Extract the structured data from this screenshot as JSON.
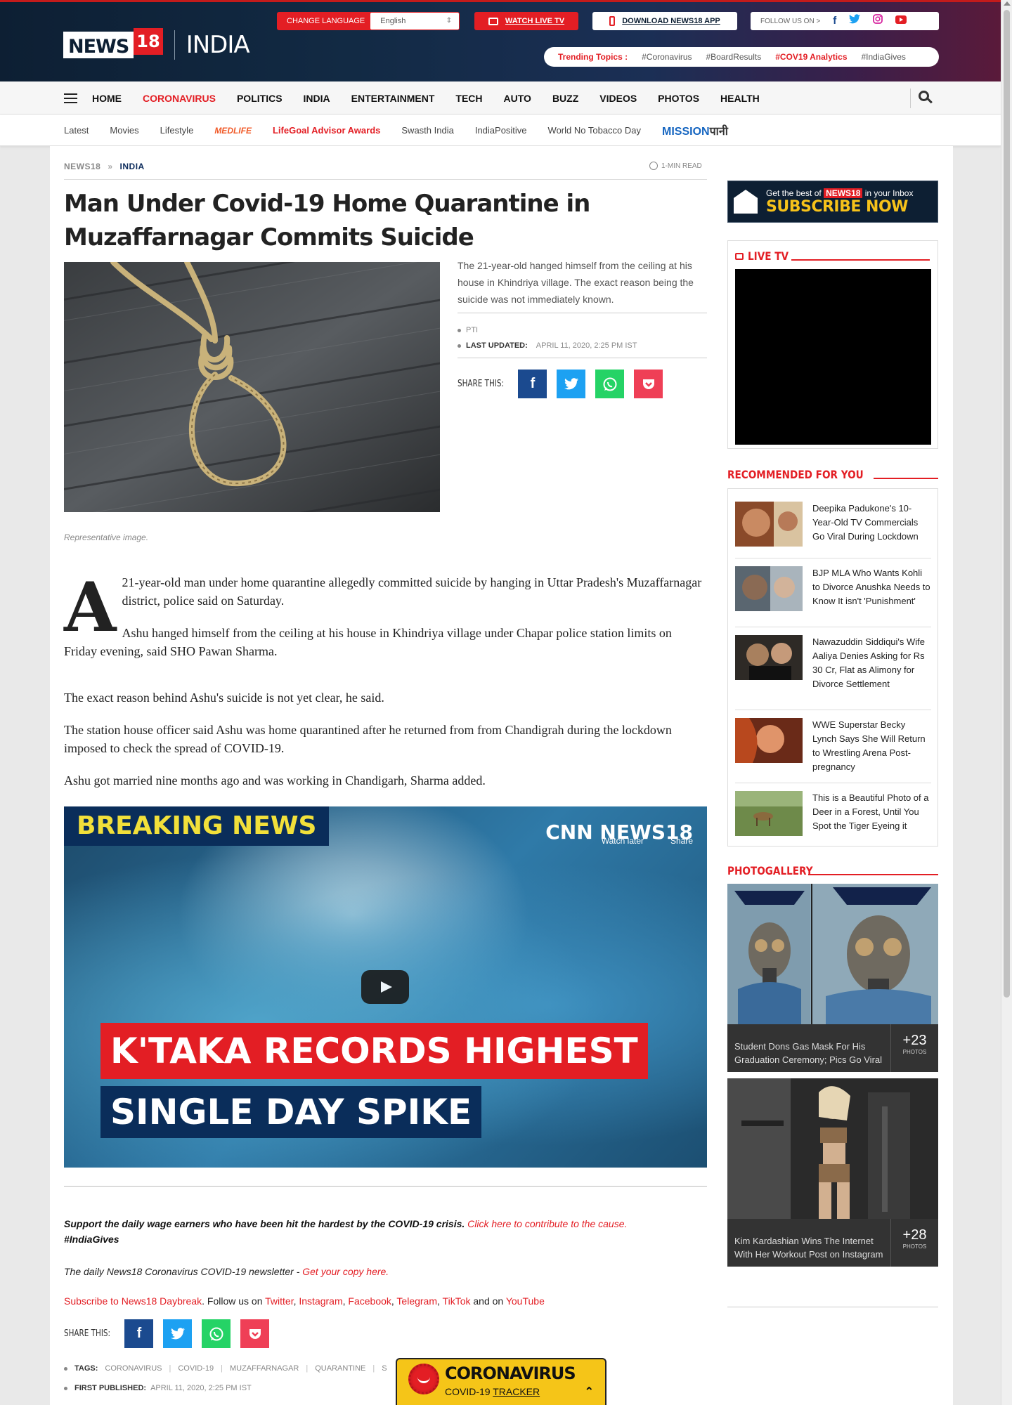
{
  "header": {
    "logo_news": "NEWS",
    "logo_18": "18",
    "logo_section": "INDIA",
    "change_language_label": "CHANGE LANGUAGE",
    "language_selected": "English",
    "watch_live_tv": "WATCH LIVE TV",
    "download_app": "DOWNLOAD NEWS18 APP",
    "follow_us": "FOLLOW US ON >",
    "social": [
      "facebook-icon",
      "twitter-icon",
      "instagram-icon",
      "youtube-icon"
    ],
    "trending_label": "Trending Topics :",
    "trending": [
      "#Coronavirus",
      "#BoardResults",
      "#COV19 Analytics",
      "#IndiaGives"
    ]
  },
  "nav": {
    "items": [
      "HOME",
      "CORONAVIRUS",
      "POLITICS",
      "INDIA",
      "ENTERTAINMENT",
      "TECH",
      "AUTO",
      "BUZZ",
      "VIDEOS",
      "PHOTOS",
      "HEALTH"
    ],
    "active": "CORONAVIRUS"
  },
  "subnav": {
    "items": [
      "Latest",
      "Movies",
      "Lifestyle",
      "MEDLIFE",
      "LifeGoal Advisor Awards",
      "Swasth India",
      "IndiaPositive",
      "World No Tobacco Day"
    ],
    "mission_1": "MISSION",
    "mission_2": "पानी"
  },
  "breadcrumb": {
    "root": "NEWS18",
    "sep": "»",
    "current": "INDIA"
  },
  "read_time": "1-MIN READ",
  "article": {
    "headline": "Man Under Covid-19 Home Quarantine in Muzaffarnagar Commits Suicide",
    "summary": "The 21-year-old hanged himself from the ceiling at his house in Khindriya village. The exact reason being the suicide was not immediately known.",
    "source": "PTI",
    "last_updated_label": "LAST UPDATED:",
    "last_updated": "APRIL 11, 2020, 2:25 PM IST",
    "share_label": "SHARE THIS:",
    "caption": "Representative image.",
    "dropcap": "A",
    "p1": "21-year-old man under home quarantine allegedly committed suicide by hanging in Uttar Pradesh's Muzaffarnagar district, police said on Saturday.",
    "p2": "Ashu hanged himself from the ceiling at his house in Khindriya village under Chapar police station limits on Friday evening, said SHO Pawan Sharma.",
    "p3": "The exact reason behind Ashu's suicide is not yet clear, he said.",
    "p4": "The station house officer said Ashu was home quarantined after he returned from from Chandigrah during the lockdown imposed to check the spread of COVID-19.",
    "p5": "Ashu got married nine months ago and was working in Chandigarh, Sharma added."
  },
  "video": {
    "breaking": "BREAKING NEWS",
    "channel": "CNN NEWS18",
    "watch_later": "Watch later",
    "share": "Share",
    "headline1": "K'TAKA RECORDS HIGHEST",
    "headline2": "SINGLE DAY SPIKE"
  },
  "footer_notes": {
    "support_text": "Support the daily wage earners who have been hit the hardest by the COVID-19 crisis.",
    "support_link": "Click here to contribute to the cause.",
    "support_tag": "#IndiaGives",
    "newsletter_text": "The daily News18 Coronavirus COVID-19 newsletter - ",
    "newsletter_link": "Get your copy here.",
    "subscribe_link": "Subscribe to News18 Daybreak",
    "follow_text": ". Follow us on ",
    "twitter": "Twitter",
    "instagram": "Instagram",
    "facebook": "Facebook",
    "telegram": "Telegram",
    "tiktok": "TikTok",
    "and_on": " and on ",
    "youtube": "YouTube",
    "tags_label": "TAGS:",
    "tags": [
      "CORONAVIRUS",
      "COVID-19",
      "MUZAFFARNAGAR",
      "QUARANTINE",
      "S"
    ],
    "first_published_label": "FIRST PUBLISHED:",
    "first_published": "APRIL 11, 2020, 2:25 PM IST"
  },
  "sidebar": {
    "subscribe_l1_a": "Get the best of ",
    "subscribe_l1_b": "NEWS18",
    "subscribe_l1_c": " in your Inbox",
    "subscribe_l2": "SUBSCRIBE NOW",
    "live_tv": "LIVE TV",
    "recommended_title": "RECOMMENDED FOR YOU",
    "recommended": [
      "Deepika Padukone's 10-Year-Old TV Commercials Go Viral During Lockdown",
      "BJP MLA Who Wants Kohli to Divorce Anushka Needs to Know It isn't 'Punishment'",
      "Nawazuddin Siddiqui's Wife Aaliya Denies Asking for Rs 30 Cr, Flat as Alimony for Divorce Settlement",
      "WWE Superstar Becky Lynch Says She Will Return to Wrestling Arena Post-pregnancy",
      "This is a Beautiful Photo of a Deer in a Forest, Until You Spot the Tiger Eyeing it"
    ],
    "photogallery_title": "PHOTOGALLERY",
    "gallery": [
      {
        "caption": "Student Dons Gas Mask For His Graduation Ceremony; Pics Go Viral",
        "count": "+23",
        "unit": "PHOTOS"
      },
      {
        "caption": "Kim Kardashian Wins The Internet With Her Workout Post on Instagram",
        "count": "+28",
        "unit": "PHOTOS"
      }
    ]
  },
  "tracker": {
    "title": "CORONAVIRUS",
    "sub_a": "COVID-19 ",
    "sub_b": "TRACKER",
    "chevron": "⌃"
  }
}
